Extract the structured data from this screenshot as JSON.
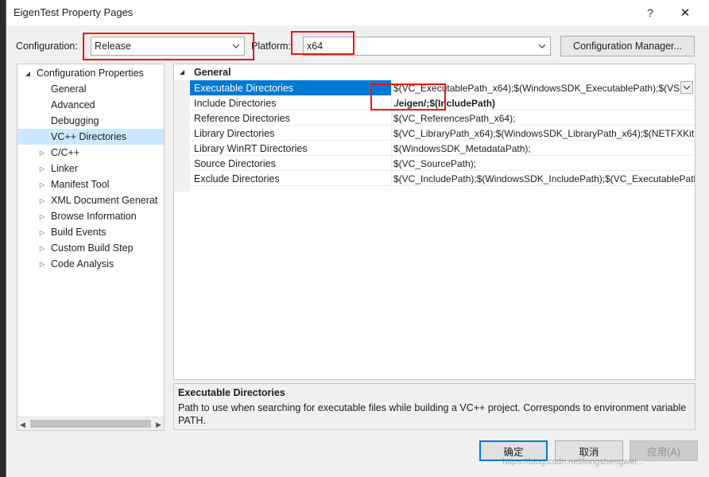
{
  "window": {
    "title": "EigenTest Property Pages",
    "help_glyph": "?",
    "close_glyph": "✕"
  },
  "config": {
    "configuration_label": "Configuration:",
    "configuration_value": "Release",
    "platform_label": "Platform:",
    "platform_value": "x64",
    "manager_button": "Configuration Manager..."
  },
  "tree": {
    "items": [
      {
        "label": "Configuration Properties",
        "level": 0,
        "expanded": true
      },
      {
        "label": "General",
        "level": 1
      },
      {
        "label": "Advanced",
        "level": 1
      },
      {
        "label": "Debugging",
        "level": 1
      },
      {
        "label": "VC++ Directories",
        "level": 1,
        "selected": true
      },
      {
        "label": "C/C++",
        "level": 1,
        "collapsed": true
      },
      {
        "label": "Linker",
        "level": 1,
        "collapsed": true
      },
      {
        "label": "Manifest Tool",
        "level": 1,
        "collapsed": true
      },
      {
        "label": "XML Document Generat",
        "level": 1,
        "collapsed": true
      },
      {
        "label": "Browse Information",
        "level": 1,
        "collapsed": true
      },
      {
        "label": "Build Events",
        "level": 1,
        "collapsed": true
      },
      {
        "label": "Custom Build Step",
        "level": 1,
        "collapsed": true
      },
      {
        "label": "Code Analysis",
        "level": 1,
        "collapsed": true
      }
    ]
  },
  "grid": {
    "category": "General",
    "rows": [
      {
        "name": "Executable Directories",
        "value": "$(VC_ExecutablePath_x64);$(WindowsSDK_ExecutablePath);$(VS",
        "selected": true
      },
      {
        "name": "Include Directories",
        "value": "./eigen/;$(IncludePath)",
        "bold": true
      },
      {
        "name": "Reference Directories",
        "value": "$(VC_ReferencesPath_x64);"
      },
      {
        "name": "Library Directories",
        "value": "$(VC_LibraryPath_x64);$(WindowsSDK_LibraryPath_x64);$(NETFXKit"
      },
      {
        "name": "Library WinRT Directories",
        "value": "$(WindowsSDK_MetadataPath);"
      },
      {
        "name": "Source Directories",
        "value": "$(VC_SourcePath);"
      },
      {
        "name": "Exclude Directories",
        "value": "$(VC_IncludePath);$(WindowsSDK_IncludePath);$(VC_ExecutablePath"
      }
    ]
  },
  "description": {
    "title": "Executable Directories",
    "text": "Path to use when searching for executable files while building a VC++ project.  Corresponds to environment variable PATH."
  },
  "buttons": {
    "ok": "确定",
    "cancel": "取消",
    "apply": "应用(A)"
  },
  "watermark": "https://blog.csdn.net/longshengwei...",
  "colors": {
    "selection": "#0078d7",
    "tree_selection": "#cce8ff",
    "annotation_red": "#f01414"
  }
}
